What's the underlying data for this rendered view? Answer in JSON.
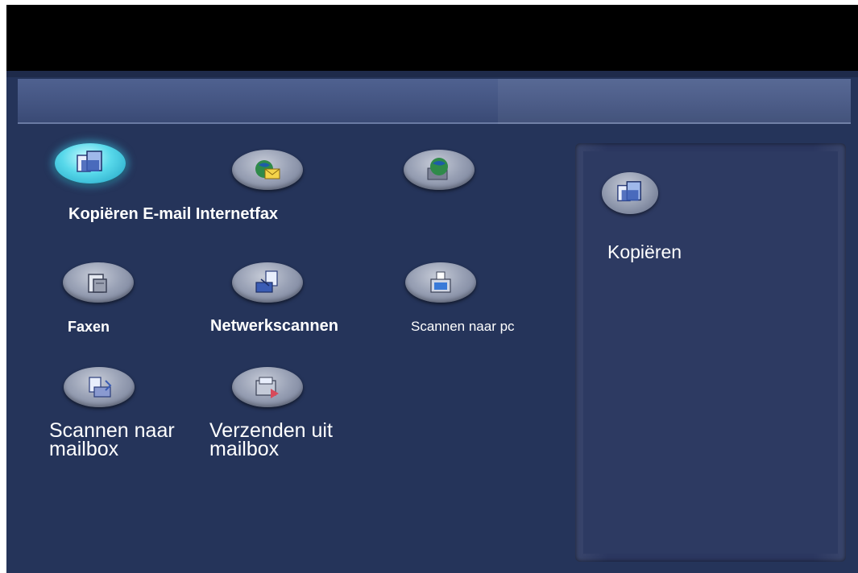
{
  "services": [
    {
      "id": "kopieren",
      "label": "Kopiëren E-mail Internetfax",
      "icon": "copy-icon",
      "selected": true
    },
    {
      "id": "email",
      "label": "",
      "icon": "email-icon",
      "selected": false
    },
    {
      "id": "internetfax",
      "label": "",
      "icon": "internet-fax-icon",
      "selected": false
    },
    {
      "id": "faxen",
      "label": "Faxen",
      "icon": "fax-icon",
      "selected": false
    },
    {
      "id": "netwerkscannen",
      "label": "Netwerkscannen",
      "icon": "network-scan-icon",
      "selected": false
    },
    {
      "id": "scannen-pc",
      "label": "Scannen naar pc",
      "icon": "scan-to-pc-icon",
      "selected": false
    },
    {
      "id": "scannen-mailbox",
      "label": "Scannen naar mailbox",
      "icon": "scan-to-mailbox-icon",
      "selected": false
    },
    {
      "id": "verzenden-mailbox",
      "label": "Verzenden uit mailbox",
      "icon": "send-from-mailbox-icon",
      "selected": false
    }
  ],
  "preview": {
    "label": "Kopiëren",
    "icon": "copy-icon"
  },
  "colors": {
    "background": "#25345a",
    "title_bar": "#435481",
    "selected_accent": "#57d8ea",
    "text": "#ffffff"
  }
}
